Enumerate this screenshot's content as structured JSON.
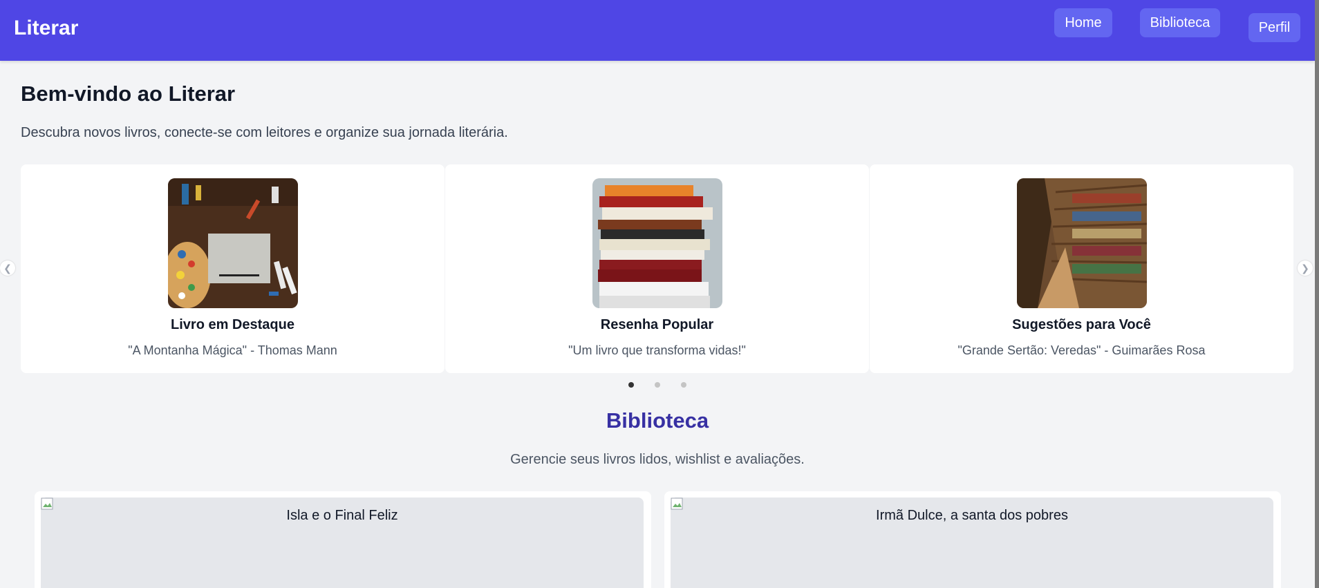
{
  "header": {
    "brand": "Literar",
    "nav": {
      "home": "Home",
      "biblioteca": "Biblioteca",
      "perfil": "Perfil"
    },
    "colors": {
      "bar": "#4f46e5",
      "button": "#6366f1"
    }
  },
  "welcome": {
    "title": "Bem-vindo ao Literar",
    "subtitle": "Descubra novos livros, conecte-se com leitores e organize sua jornada literária."
  },
  "carousel": {
    "slides": [
      {
        "image": "art-desk-palette-image",
        "title": "Livro em Destaque",
        "text": "\"A Montanha Mágica\" - Thomas Mann"
      },
      {
        "image": "book-stack-image",
        "title": "Resenha Popular",
        "text": "\"Um livro que transforma vidas!\""
      },
      {
        "image": "library-shelves-image",
        "title": "Sugestões para Você",
        "text": "\"Grande Sertão: Veredas\" - Guimarães Rosa"
      }
    ],
    "prev_icon": "chevron-left-icon",
    "next_icon": "chevron-right-icon",
    "active_dot": 1,
    "dot_count": 3
  },
  "biblioteca": {
    "title": "Biblioteca",
    "subtitle": "Gerencie seus livros lidos, wishlist e avaliações.",
    "books": [
      {
        "alt": "Isla e o Final Feliz"
      },
      {
        "alt": "Irmã Dulce, a santa dos pobres"
      }
    ],
    "title_color": "#3730a3"
  }
}
